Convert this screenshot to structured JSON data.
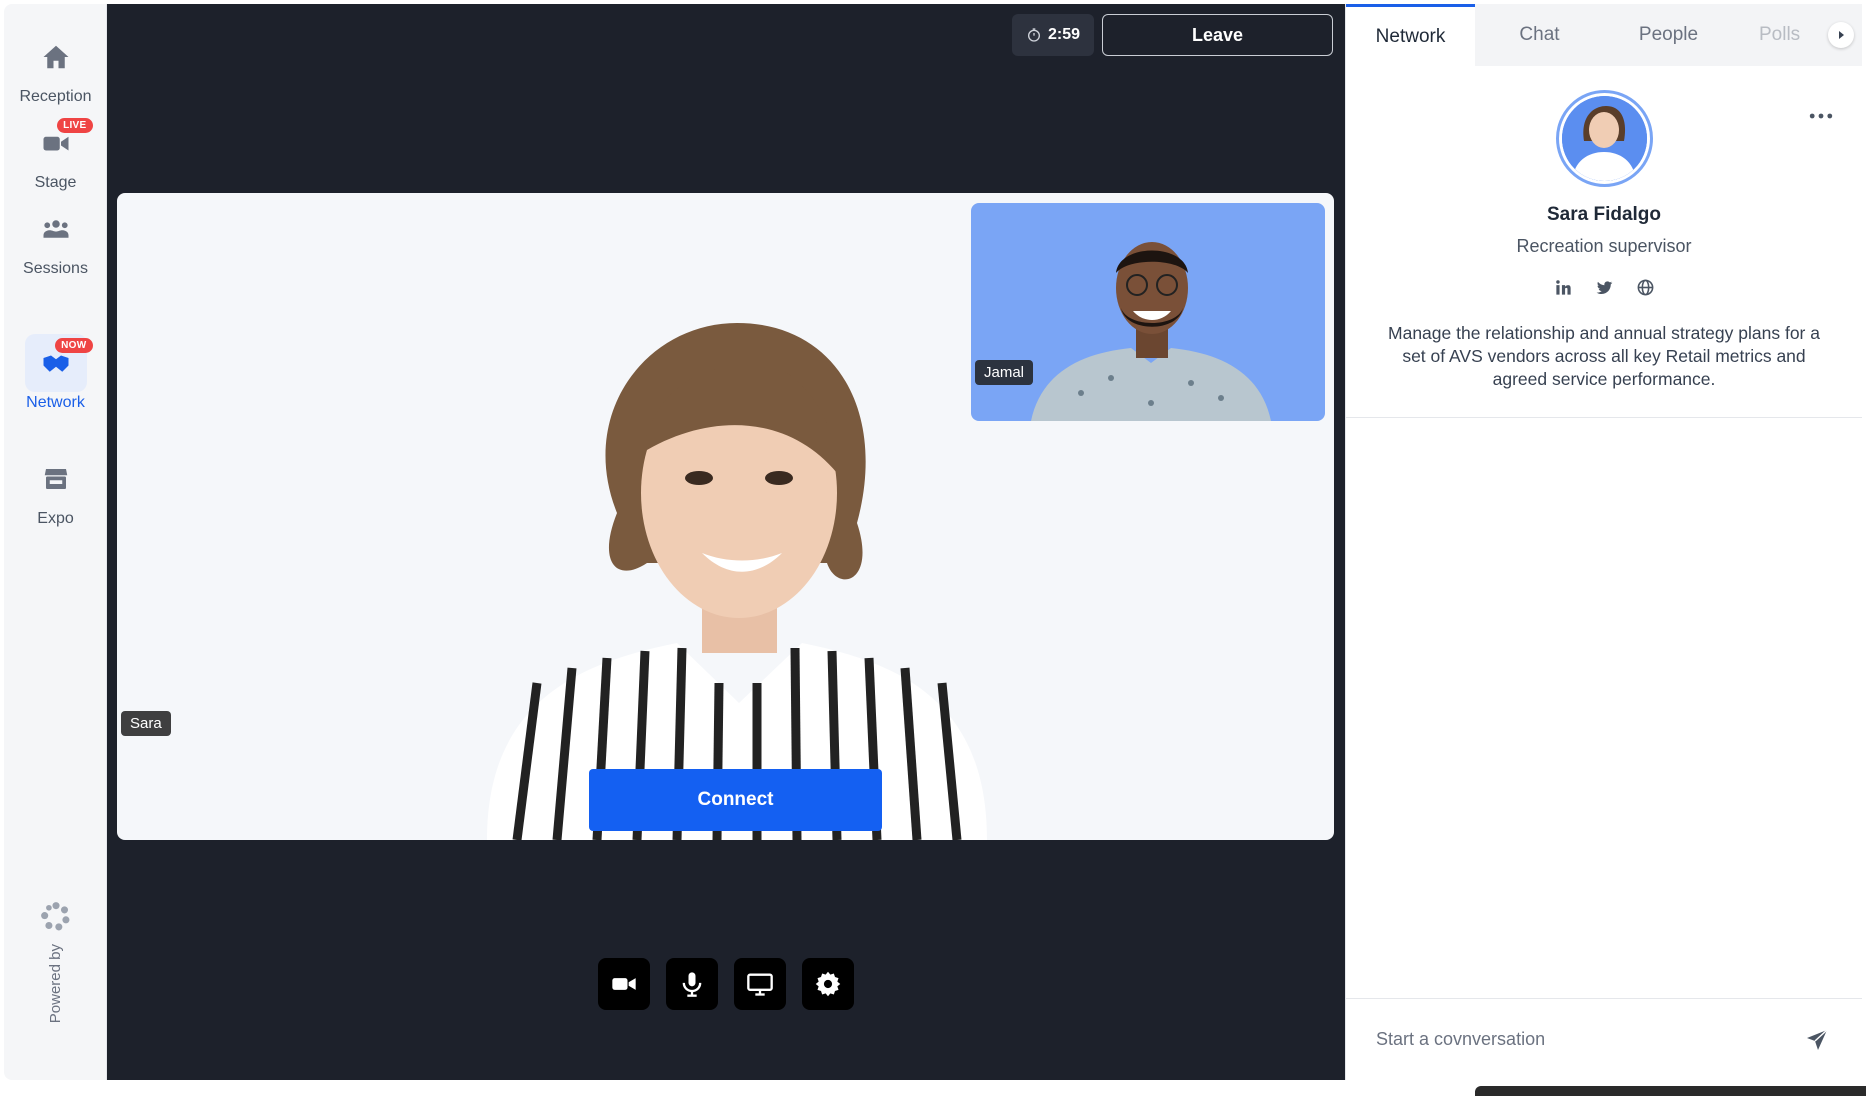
{
  "sidebar": {
    "items": [
      {
        "label": "Reception",
        "icon": "home-icon"
      },
      {
        "label": "Stage",
        "icon": "video-camera-icon",
        "badge": "LIVE"
      },
      {
        "label": "Sessions",
        "icon": "group-icon"
      },
      {
        "label": "Network",
        "icon": "handshake-icon",
        "badge": "NOW",
        "active": true
      },
      {
        "label": "Expo",
        "icon": "storefront-icon"
      }
    ],
    "powered_by": "Powered by"
  },
  "stage": {
    "timer": "2:59",
    "leave_label": "Leave",
    "main_participant": "Sara",
    "pip_participant": "Jamal",
    "connect_label": "Connect",
    "controls": [
      "camera-icon",
      "microphone-icon",
      "screen-share-icon",
      "settings-icon"
    ]
  },
  "panel": {
    "tabs": [
      "Network",
      "Chat",
      "People",
      "Polls"
    ],
    "active_tab": "Network",
    "profile": {
      "name": "Sara Fidalgo",
      "role": "Recreation supervisor",
      "bio": "Manage the relationship and annual strategy plans for a set of AVS vendors across all key Retail metrics and agreed service performance."
    },
    "composer_placeholder": "Start a covnversation"
  },
  "colors": {
    "accent": "#1a5fe8",
    "stage_bg": "#1d212b",
    "connect": "#1460f2",
    "badge": "#ef4444",
    "pip_bg": "#7aa5f5"
  }
}
